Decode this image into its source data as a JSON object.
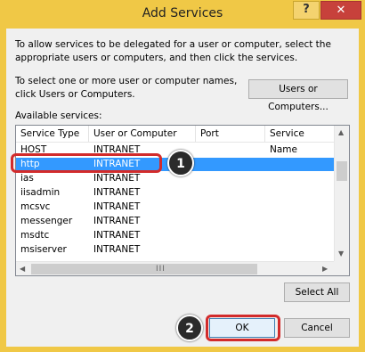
{
  "window": {
    "title": "Add Services",
    "help_glyph": "?",
    "close_glyph": "✕"
  },
  "instructions": {
    "line1": "To allow services to be delegated for a user or computer, select the appropriate users or computers, and then click the services.",
    "line2": "To select one or more user or computer names, click Users or Computers."
  },
  "buttons": {
    "users_or_computers": "Users or Computers...",
    "select_all": "Select All",
    "ok": "OK",
    "cancel": "Cancel"
  },
  "services": {
    "label": "Available services:",
    "columns": [
      "Service Type",
      "User or Computer",
      "Port",
      "Service Name"
    ],
    "rows": [
      {
        "service_type": "HOST",
        "user_or_computer": "INTRANET",
        "port": "",
        "service_name": ""
      },
      {
        "service_type": "http",
        "user_or_computer": "INTRANET",
        "port": "",
        "service_name": "",
        "selected": true
      },
      {
        "service_type": "ias",
        "user_or_computer": "INTRANET",
        "port": "",
        "service_name": ""
      },
      {
        "service_type": "iisadmin",
        "user_or_computer": "INTRANET",
        "port": "",
        "service_name": ""
      },
      {
        "service_type": "mcsvc",
        "user_or_computer": "INTRANET",
        "port": "",
        "service_name": ""
      },
      {
        "service_type": "messenger",
        "user_or_computer": "INTRANET",
        "port": "",
        "service_name": ""
      },
      {
        "service_type": "msdtc",
        "user_or_computer": "INTRANET",
        "port": "",
        "service_name": ""
      },
      {
        "service_type": "msiserver",
        "user_or_computer": "INTRANET",
        "port": "",
        "service_name": ""
      }
    ],
    "hscroll_grip": "III"
  },
  "annotations": {
    "step1": "1",
    "step2": "2"
  },
  "colors": {
    "title_bar": "#f0c846",
    "selection": "#3399ff",
    "highlight": "#d22b2b",
    "close": "#c7413b"
  }
}
